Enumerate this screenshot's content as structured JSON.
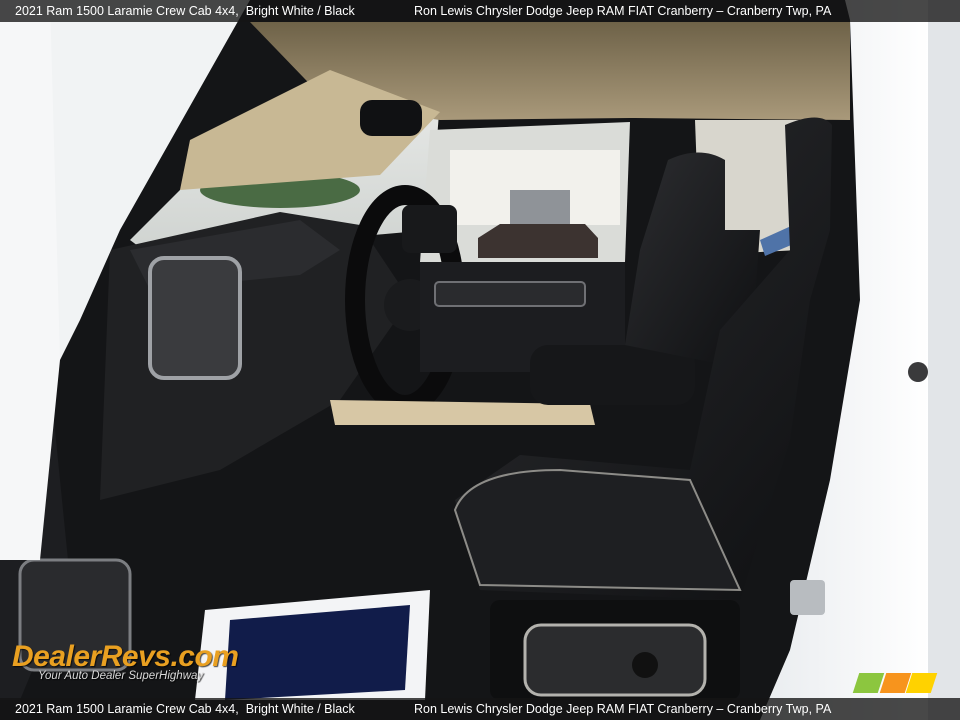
{
  "caption": {
    "vehicle": "2021 Ram 1500 Laramie Crew Cab 4x4,",
    "color": "Bright White / Black",
    "dealer": "Ron Lewis Chrysler Dodge Jeep RAM FIAT Cranberry – Cranberry Twp, PA"
  },
  "watermark": {
    "logo_text": "DealerRevs.com",
    "tagline": "Your Auto Dealer SuperHighway"
  },
  "colors": {
    "badge": [
      "#8cc63f",
      "#f7941d",
      "#ffd200"
    ],
    "watermark_accent": "#e9a021"
  },
  "photo_subject": "front-interior-driver-side-view"
}
